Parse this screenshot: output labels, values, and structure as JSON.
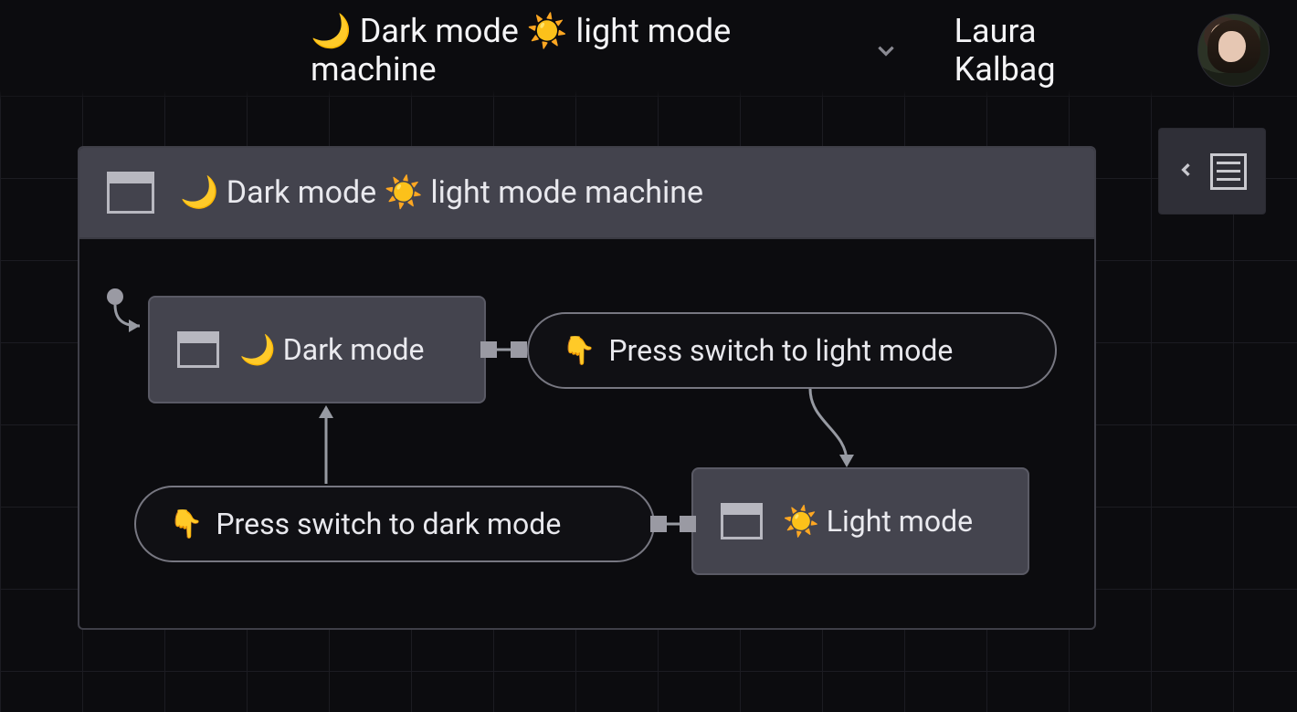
{
  "header": {
    "title": "🌙 Dark mode ☀️ light mode machine",
    "username": "Laura Kalbag"
  },
  "machine": {
    "title": "🌙 Dark mode ☀️ light mode machine",
    "states": {
      "dark": {
        "label": "🌙 Dark mode"
      },
      "light": {
        "label": "☀️ Light mode"
      }
    },
    "events": {
      "to_light": {
        "emoji": "👇",
        "label": "Press switch to light mode"
      },
      "to_dark": {
        "emoji": "👇",
        "label": "Press switch to dark mode"
      }
    }
  }
}
